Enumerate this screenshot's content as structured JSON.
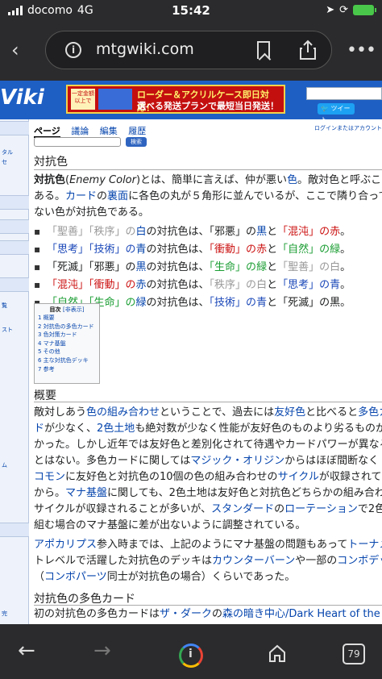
{
  "status": {
    "carrier": "docomo",
    "network": "4G",
    "time": "15:42"
  },
  "browser": {
    "url": "mtgwiki.com",
    "tab_count": "79"
  },
  "site": {
    "logo": "Viki",
    "banner_badge": "一定金額以上で",
    "banner_line1": "ローダー＆アクリルケース即日対応！",
    "banner_line2": "選べる発送プランで最短当日発送！",
    "tweet": "ツイート",
    "login": "ログインまたはアカウント",
    "search_button": "検索",
    "sidebar_labels": [
      "タル",
      "セ",
      "覧",
      "スト",
      "ム",
      "完"
    ]
  },
  "page": {
    "tabs": [
      "ページ",
      "議論",
      "編集",
      "履歴"
    ],
    "title": "対抗色",
    "intro": {
      "l1a": "対抗色",
      "l1b": "(",
      "l1c": "Enemy Color",
      "l1d": ")とは、簡単に言えば、仲が悪い",
      "l1e": "色",
      "l1f": "。敵対色と呼ぶこ",
      "l2a": "ある。",
      "l2b": "カード",
      "l2c": "の",
      "l2d": "裏面",
      "l2e": "に各色の丸が５角形に並んでいるが、ここで隣り合って",
      "l3": "ない色が対抗色である。"
    },
    "bullets": [
      [
        "「聖善」「秩序」の",
        "白",
        "の対抗色は、",
        "「邪悪」の",
        "黒",
        "と",
        "「混沌」の",
        "赤",
        "。"
      ],
      [
        "「思考」「技術」の",
        "青",
        "の対抗色は、",
        "「衝動」の",
        "赤",
        "と",
        "「自然」の",
        "緑",
        "。"
      ],
      [
        "「死滅」「邪悪」の",
        "黒",
        "の対抗色は、",
        "「生命」の",
        "緑",
        "と",
        "「聖善」の",
        "白",
        "。"
      ],
      [
        "「混沌」「衝動」の",
        "赤",
        "の対抗色は、",
        "「秩序」の",
        "白",
        "と",
        "「思考」の",
        "青",
        "。"
      ],
      [
        "「自然」「生命」の",
        "緑",
        "の対抗色は、",
        "「技術」の",
        "青",
        "と",
        "「死滅」の",
        "黒",
        "。"
      ]
    ],
    "toc": {
      "title": "目次",
      "hide": "[非表示]",
      "items": [
        "1 概要",
        "2 対抗色の多色カード",
        "3 色対策カード",
        "4 マナ基盤",
        "5 その他",
        "6 主な対抗色デッキ",
        "7 参考"
      ]
    },
    "section1": {
      "heading": "概要",
      "r1": [
        "敵対しあう",
        "色の組み合わせ",
        "ということで、過去には",
        "友好色",
        "と比べると",
        "多色カー"
      ],
      "r2": [
        "ド",
        "が少なく、",
        "2色土地",
        "も絶対数が少なく性能が友好色のものより劣るものが"
      ],
      "r3": [
        "かった。しかし近年では友好色と差別化されて待遇やカードパワーが異なるこ"
      ],
      "r4": [
        "とはない。多色カードに関しては",
        "マジック・オリジン",
        "からはほぼ間断なく"
      ],
      "r5": [
        "コモン",
        "に友好色と対抗色の10個の色の組み合わせの",
        "サイクル",
        "が収録されて"
      ],
      "r6": [
        "から。",
        "マナ基盤",
        "に関しても、2色土地は友好色と対抗色どちらかの組み合わせで"
      ],
      "r7": [
        "サイクルが収録されることが多いが、",
        "スタンダード",
        "の",
        "ローテーション",
        "で2色の"
      ],
      "r8": [
        "組む場合のマナ基盤に差が出ないように調整されている。"
      ],
      "r9": [
        "アポカリプス",
        "参入時までは、上記のようにマナ基盤の問題もあって",
        "トーナメン"
      ],
      "r10": [
        "トレベルで活躍した対抗色のデッキは",
        "カウンターバーン",
        "や一部の",
        "コンボデッ"
      ],
      "r11": [
        "（",
        "コンボパーツ",
        "同士が対抗色の場合）くらいであった。"
      ]
    },
    "section2": {
      "heading": "対抗色の多色カード",
      "r1": [
        "初の対抗色の多色カードは",
        "ザ・ダーク",
        "の",
        "森の暗き中心/Dark Heart of the"
      ]
    }
  }
}
